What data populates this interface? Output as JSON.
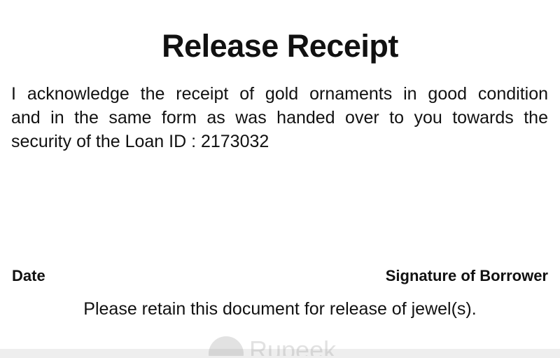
{
  "document": {
    "title": "Release Receipt",
    "body_lines": [
      "I acknowledge the receipt of gold ornaments in good condition",
      "and in the same form as was handed over to you towards the",
      "security of the Loan ID : 2173032"
    ],
    "date_label": "Date",
    "signature_label": "Signature of Borrower",
    "footer_note": "Please retain this document for release of jewel(s)."
  },
  "watermark": {
    "icon": "rupee-logo-icon",
    "text": "Rupeek"
  },
  "colors": {
    "text": "#111111",
    "background": "#ffffff",
    "bottom_strip": "#eeeeee"
  }
}
